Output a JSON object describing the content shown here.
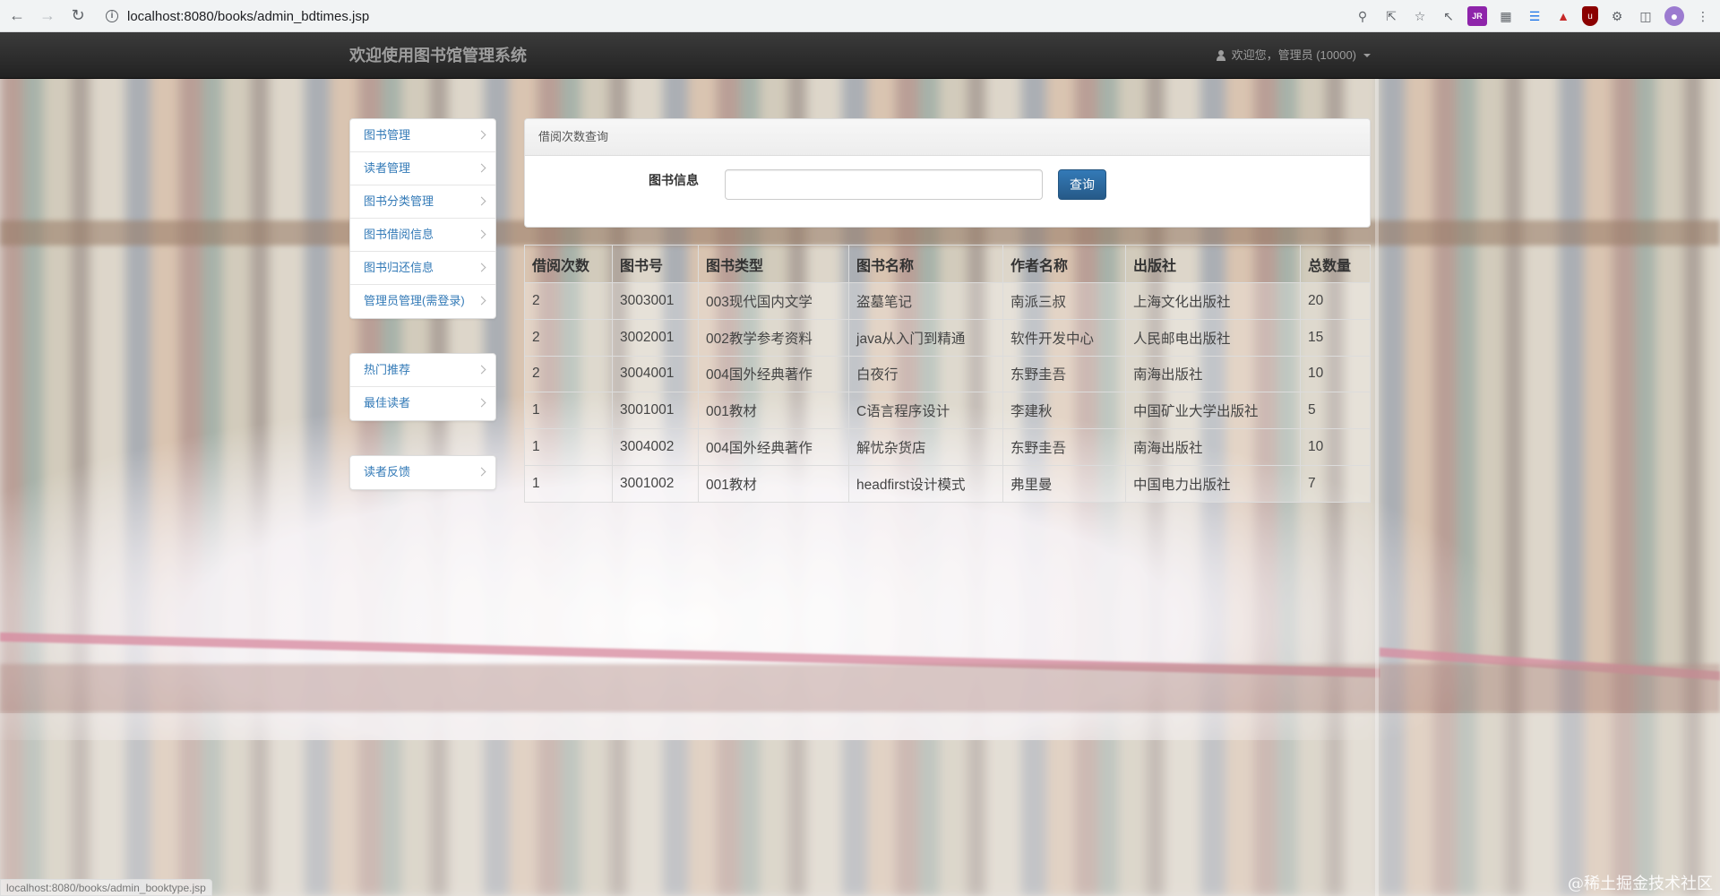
{
  "browser": {
    "url": "localhost:8080/books/admin_bdtimes.jsp",
    "status_url": "localhost:8080/books/admin_booktype.jsp",
    "back_icon": "arrow-left-icon",
    "forward_icon": "arrow-right-icon",
    "reload_icon": "reload-icon",
    "extensions": [
      "key-icon",
      "share-icon",
      "star-icon",
      "cursor-icon",
      "jrp-icon",
      "grid-icon",
      "stack-icon",
      "fire-icon",
      "ublock-icon",
      "puzzle-icon",
      "sidepanel-icon",
      "profile-icon",
      "menu-dots-icon"
    ]
  },
  "navbar": {
    "brand": "欢迎使用图书馆管理系统",
    "user_label": "欢迎您，管理员 (10000)"
  },
  "sidebar": {
    "group1": [
      {
        "label": "图书管理"
      },
      {
        "label": "读者管理"
      },
      {
        "label": "图书分类管理"
      },
      {
        "label": "图书借阅信息"
      },
      {
        "label": "图书归还信息"
      },
      {
        "label": "管理员管理(需登录)"
      }
    ],
    "group2": [
      {
        "label": "热门推荐"
      },
      {
        "label": "最佳读者"
      }
    ],
    "group3": [
      {
        "label": "读者反馈"
      }
    ]
  },
  "query_panel": {
    "title": "借阅次数查询",
    "field_label": "图书信息",
    "input_value": "",
    "button_label": "查询"
  },
  "table": {
    "headers": [
      "借阅次数",
      "图书号",
      "图书类型",
      "图书名称",
      "作者名称",
      "出版社",
      "总数量"
    ],
    "rows": [
      [
        "2",
        "3003001",
        "003现代国内文学",
        "盗墓笔记",
        "南派三叔",
        "上海文化出版社",
        "20"
      ],
      [
        "2",
        "3002001",
        "002教学参考资料",
        "java从入门到精通",
        "软件开发中心",
        "人民邮电出版社",
        "15"
      ],
      [
        "2",
        "3004001",
        "004国外经典著作",
        "白夜行",
        "东野圭吾",
        "南海出版社",
        "10"
      ],
      [
        "1",
        "3001001",
        "001教材",
        "C语言程序设计",
        "李建秋",
        "中国矿业大学出版社",
        "5"
      ],
      [
        "1",
        "3004002",
        "004国外经典著作",
        "解忧杂货店",
        "东野圭吾",
        "南海出版社",
        "10"
      ],
      [
        "1",
        "3001002",
        "001教材",
        "headfirst设计模式",
        "弗里曼",
        "中国电力出版社",
        "7"
      ]
    ]
  },
  "watermark": "@稀土掘金技术社区",
  "colors": {
    "navbar_bg": "#222222",
    "link": "#337ab7",
    "primary_button": "#337ab7"
  }
}
